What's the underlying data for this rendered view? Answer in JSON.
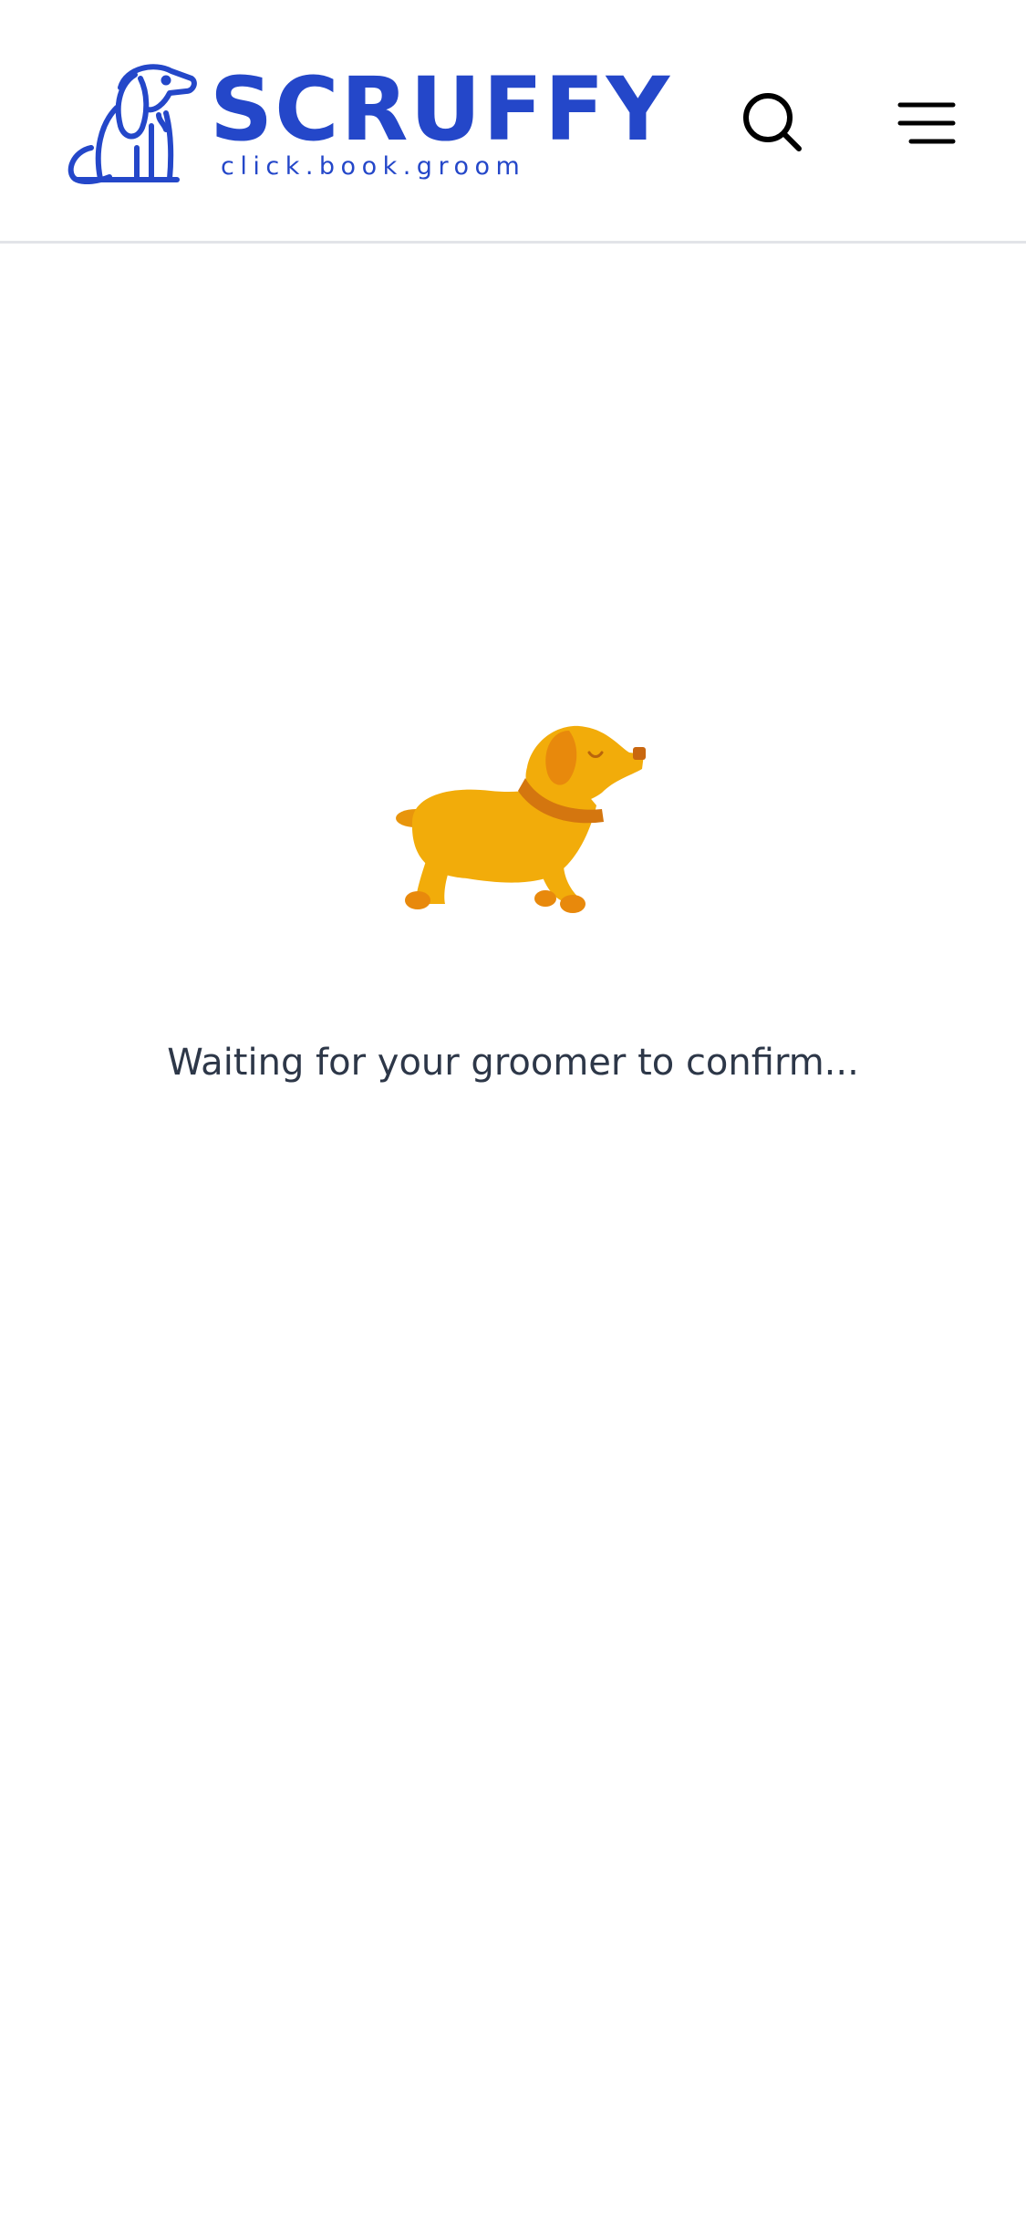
{
  "header": {
    "brand_name": "SCRUFFY",
    "tagline": "click.book.groom",
    "brand_color": "#2447c9",
    "icons": [
      "search-icon",
      "menu-icon"
    ]
  },
  "main": {
    "status_text": "Waiting for your groomer to confirm...",
    "illustration": "walking-dog-icon",
    "dog_color": "#f2ac0a",
    "ear_color": "#e8890c",
    "collar_color": "#d4760f"
  }
}
